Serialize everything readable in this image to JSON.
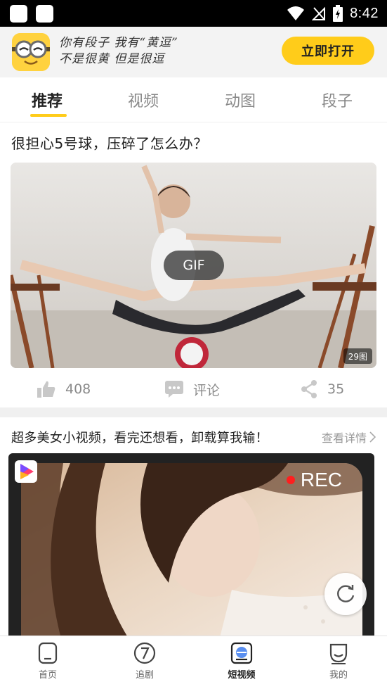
{
  "status_bar": {
    "time": "8:42"
  },
  "banner": {
    "line1": "你有段子 我有“黄逗”",
    "line2": "不是很黄 但是很逗",
    "button": "立即打开",
    "accent": "#ffcc1a"
  },
  "tabs": [
    {
      "label": "推荐",
      "active": true
    },
    {
      "label": "视频",
      "active": false
    },
    {
      "label": "动图",
      "active": false
    },
    {
      "label": "段子",
      "active": false
    }
  ],
  "post1": {
    "title": "很担心5号球，压碎了怎么办？",
    "media_badge": "GIF",
    "image_count": "29图",
    "likes": "408",
    "comment_label": "评论",
    "shares": "35"
  },
  "post2": {
    "title": "超多美女小视频，看完还想看，卸载算我输！",
    "detail_link": "查看详情",
    "rec_label": "REC"
  },
  "bottom_nav": [
    {
      "label": "首页",
      "icon": "home-icon",
      "active": false
    },
    {
      "label": "追剧",
      "icon": "drama-icon",
      "active": false
    },
    {
      "label": "短视频",
      "icon": "short-video-icon",
      "active": true
    },
    {
      "label": "我的",
      "icon": "profile-icon",
      "active": false
    }
  ]
}
